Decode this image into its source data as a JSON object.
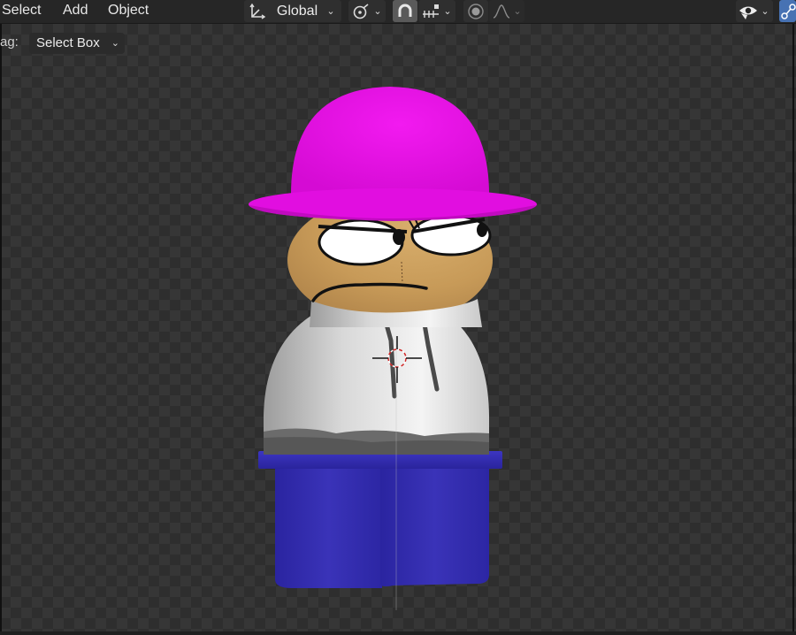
{
  "header": {
    "menus": [
      "Select",
      "Add",
      "Object"
    ],
    "orientation_label": "Global",
    "icons": {
      "orientation": "transform-orientation-icon",
      "pivot": "pivot-point-icon",
      "snap": "magnet-snap-icon",
      "snap_target": "snap-increment-icon",
      "proportional": "proportional-editing-icon",
      "falloff": "falloff-curve-icon",
      "visibility": "eye-visibility-icon",
      "gizmo": "gizmo-toggle-icon"
    },
    "accent_color": "#4772b3"
  },
  "toolbar": {
    "drag_label": "ag:",
    "select_mode": "Select Box"
  },
  "viewport": {
    "background": "transparent-checker",
    "object": "cartoon-character",
    "colors": {
      "hat": "#e60fe3",
      "skin": "#c99a56",
      "shirt": "#dcdcdc",
      "pants": "#2e28a8"
    }
  }
}
